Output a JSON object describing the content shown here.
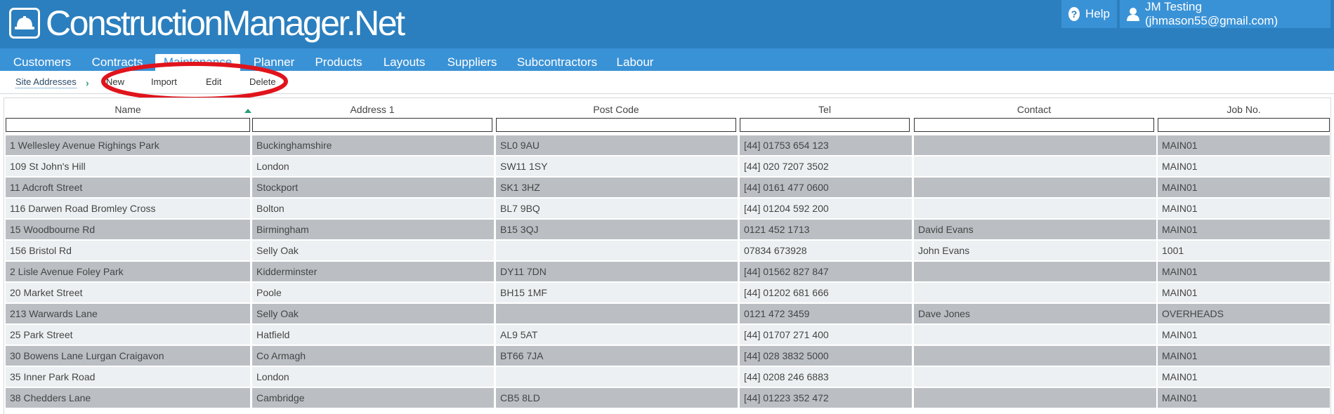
{
  "app": {
    "title": "ConstructionManager.Net",
    "help_label": "Help",
    "user_label": "JM Testing (jhmason55@gmail.com)"
  },
  "nav": {
    "tabs": [
      {
        "label": "Customers"
      },
      {
        "label": "Contracts"
      },
      {
        "label": "Maintenance",
        "active": true
      },
      {
        "label": "Planner"
      },
      {
        "label": "Products"
      },
      {
        "label": "Layouts"
      },
      {
        "label": "Suppliers"
      },
      {
        "label": "Subcontractors"
      },
      {
        "label": "Labour"
      }
    ]
  },
  "toolbar": {
    "breadcrumb": "Site Addresses",
    "new_label": "New",
    "import_label": "Import",
    "edit_label": "Edit",
    "delete_label": "Delete"
  },
  "table": {
    "columns": [
      "Name",
      "Address 1",
      "Post Code",
      "Tel",
      "Contact",
      "Job No."
    ],
    "sorted_column": "Name",
    "rows": [
      [
        "1 Wellesley Avenue Righings Park",
        "Buckinghamshire",
        "SL0 9AU",
        "[44] 01753 654 123",
        "",
        "MAIN01"
      ],
      [
        "109 St John's Hill",
        "London",
        "SW11 1SY",
        "[44] 020 7207 3502",
        "",
        "MAIN01"
      ],
      [
        "11 Adcroft Street",
        "Stockport",
        "SK1 3HZ",
        "[44] 0161 477 0600",
        "",
        "MAIN01"
      ],
      [
        "116 Darwen Road Bromley Cross",
        "Bolton",
        "BL7 9BQ",
        "[44] 01204 592 200",
        "",
        "MAIN01"
      ],
      [
        "15 Woodbourne Rd",
        "Birmingham",
        "B15 3QJ",
        "0121 452 1713",
        "David Evans",
        "MAIN01"
      ],
      [
        "156 Bristol Rd",
        "Selly Oak",
        "",
        "07834 673928",
        "John Evans",
        "1001"
      ],
      [
        "2 Lisle Avenue Foley Park",
        "Kidderminster",
        "DY11 7DN",
        "[44] 01562 827 847",
        "",
        "MAIN01"
      ],
      [
        "20 Market Street",
        "Poole",
        "BH15 1MF",
        "[44] 01202 681 666",
        "",
        "MAIN01"
      ],
      [
        "213 Warwards Lane",
        "Selly Oak",
        "",
        "0121 472 3459",
        "Dave Jones",
        "OVERHEADS"
      ],
      [
        "25 Park Street",
        "Hatfield",
        "AL9 5AT",
        "[44] 01707 271 400",
        "",
        "MAIN01"
      ],
      [
        "30 Bowens Lane Lurgan Craigavon",
        "Co Armagh",
        "BT66 7JA",
        "[44] 028 3832 5000",
        "",
        "MAIN01"
      ],
      [
        "35 Inner Park Road",
        "London",
        "",
        "[44] 0208 246 6883",
        "",
        "MAIN01"
      ],
      [
        "38 Chedders Lane",
        "Cambridge",
        "CB5 8LD",
        "[44] 01223 352 472",
        "",
        "MAIN01"
      ]
    ]
  },
  "colors": {
    "header_bg": "#2b7fbe",
    "nav_bg": "#3a92d6",
    "row_dark": "#bbbfc4",
    "row_light": "#edf0f2",
    "annotation": "#e0141c"
  }
}
